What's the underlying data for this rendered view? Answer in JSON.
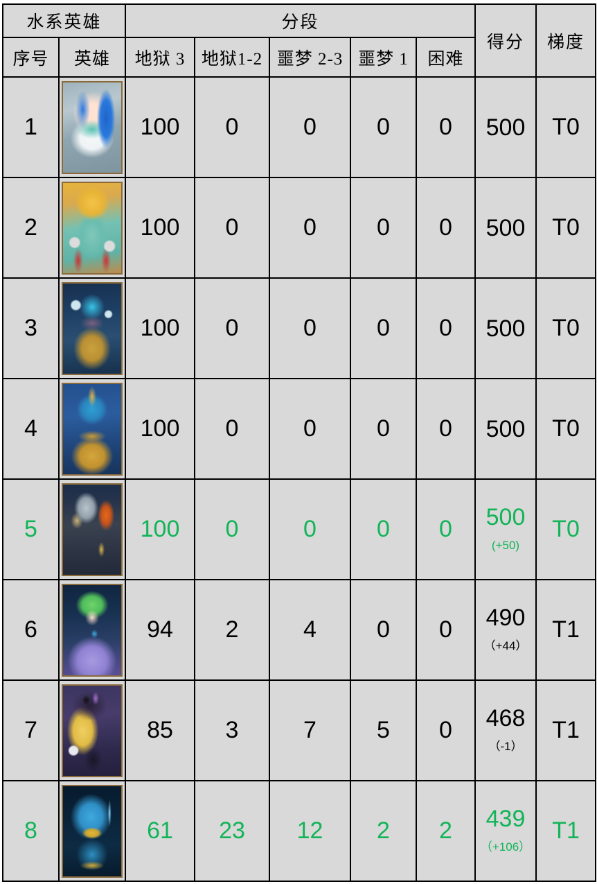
{
  "table": {
    "group_headers": {
      "hero_group": "水系英雄",
      "tier_group": "分段",
      "score": "得分",
      "grade": "梯度"
    },
    "columns": {
      "index": "序号",
      "hero": "英雄",
      "hell3": "地狱 3",
      "hell12": "地狱1-2",
      "nightmare23": "噩梦 2-3",
      "nightmare1": "噩梦 1",
      "hard": "困难"
    },
    "accent_green": "#12b457",
    "text_black": "#000000",
    "cell_background": "#d9d9d9",
    "border_color": "#000000"
  },
  "rows": [
    {
      "index": "1",
      "hero_art": "p1",
      "hero_alt": "water-hero-portrait-1",
      "hell3": "100",
      "hell12": "0",
      "nightmare23": "0",
      "nightmare1": "0",
      "hard": "0",
      "score": "500",
      "delta": "",
      "grade": "T0",
      "highlight": false
    },
    {
      "index": "2",
      "hero_art": "p2",
      "hero_alt": "water-hero-portrait-2",
      "hell3": "100",
      "hell12": "0",
      "nightmare23": "0",
      "nightmare1": "0",
      "hard": "0",
      "score": "500",
      "delta": "",
      "grade": "T0",
      "highlight": false
    },
    {
      "index": "3",
      "hero_art": "p3",
      "hero_alt": "water-hero-portrait-3",
      "hell3": "100",
      "hell12": "0",
      "nightmare23": "0",
      "nightmare1": "0",
      "hard": "0",
      "score": "500",
      "delta": "",
      "grade": "T0",
      "highlight": false
    },
    {
      "index": "4",
      "hero_art": "p4",
      "hero_alt": "water-hero-portrait-4",
      "hell3": "100",
      "hell12": "0",
      "nightmare23": "0",
      "nightmare1": "0",
      "hard": "0",
      "score": "500",
      "delta": "",
      "grade": "T0",
      "highlight": false
    },
    {
      "index": "5",
      "hero_art": "p5",
      "hero_alt": "water-hero-portrait-5",
      "hell3": "100",
      "hell12": "0",
      "nightmare23": "0",
      "nightmare1": "0",
      "hard": "0",
      "score": "500",
      "delta": "(+50)",
      "grade": "T0",
      "highlight": true
    },
    {
      "index": "6",
      "hero_art": "p6",
      "hero_alt": "water-hero-portrait-6",
      "hell3": "94",
      "hell12": "2",
      "nightmare23": "4",
      "nightmare1": "0",
      "hard": "0",
      "score": "490",
      "delta": "（+44）",
      "grade": "T1",
      "highlight": false
    },
    {
      "index": "7",
      "hero_art": "p7",
      "hero_alt": "water-hero-portrait-7",
      "hell3": "85",
      "hell12": "3",
      "nightmare23": "7",
      "nightmare1": "5",
      "hard": "0",
      "score": "468",
      "delta": "（-1）",
      "grade": "T1",
      "highlight": false
    },
    {
      "index": "8",
      "hero_art": "p8",
      "hero_alt": "water-hero-portrait-8",
      "hell3": "61",
      "hell12": "23",
      "nightmare23": "12",
      "nightmare1": "2",
      "hard": "2",
      "score": "439",
      "delta": "（+106）",
      "grade": "T1",
      "highlight": true
    }
  ]
}
